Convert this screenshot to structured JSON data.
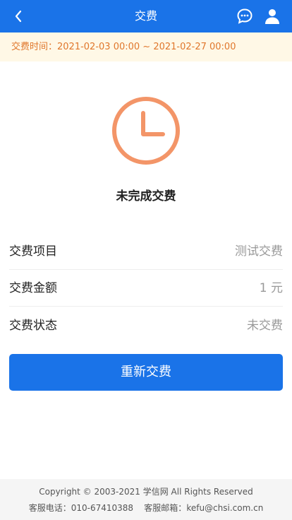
{
  "header": {
    "title": "交费",
    "back_icon": "chevron-left-icon",
    "chat_icon": "chat-bubble-icon",
    "user_icon": "user-icon",
    "background": "#1a73e8"
  },
  "notice": {
    "label": "交费时间：",
    "range": "2021-02-03 00:00 ~ 2021-02-27 00:00",
    "text_color": "#e0772c"
  },
  "status": {
    "icon": "clock-icon",
    "icon_color": "#f39568",
    "text": "未完成交费"
  },
  "details": [
    {
      "label": "交费项目",
      "value": "测试交费"
    },
    {
      "label": "交费金额",
      "value": "1 元"
    },
    {
      "label": "交费状态",
      "value": "未交费"
    }
  ],
  "actions": {
    "repay_label": "重新交费"
  },
  "footer": {
    "copyright": "Copyright © 2003-2021 学信网 All Rights Reserved",
    "phone_label": "客服电话：",
    "phone": "010-67410388",
    "email_label": "客服邮箱：",
    "email": "kefu@chsi.com.cn"
  }
}
